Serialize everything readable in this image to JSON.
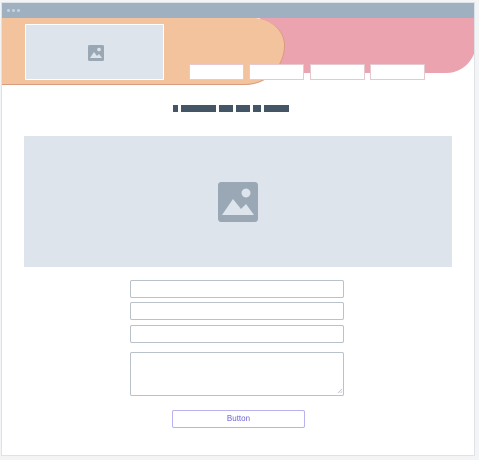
{
  "window": {
    "titlebar_dots": 3
  },
  "header": {
    "logo_icon": "image-placeholder-icon",
    "nav_items": [
      "",
      "",
      "",
      ""
    ]
  },
  "main": {
    "title": "",
    "hero_icon": "image-placeholder-icon"
  },
  "form": {
    "field_1_value": "",
    "field_2_value": "",
    "field_3_value": "",
    "message_value": "",
    "button_label": "Button"
  },
  "colors": {
    "titlebar": "#9fb0c0",
    "header_orange": "#f3c39e",
    "header_pink": "#eba3b0",
    "placeholder_bg": "#dde4ec",
    "icon": "#9aa8b6",
    "title_bars": "#445566",
    "button_text": "#6a5fd8",
    "button_border": "#b8b3f0"
  }
}
